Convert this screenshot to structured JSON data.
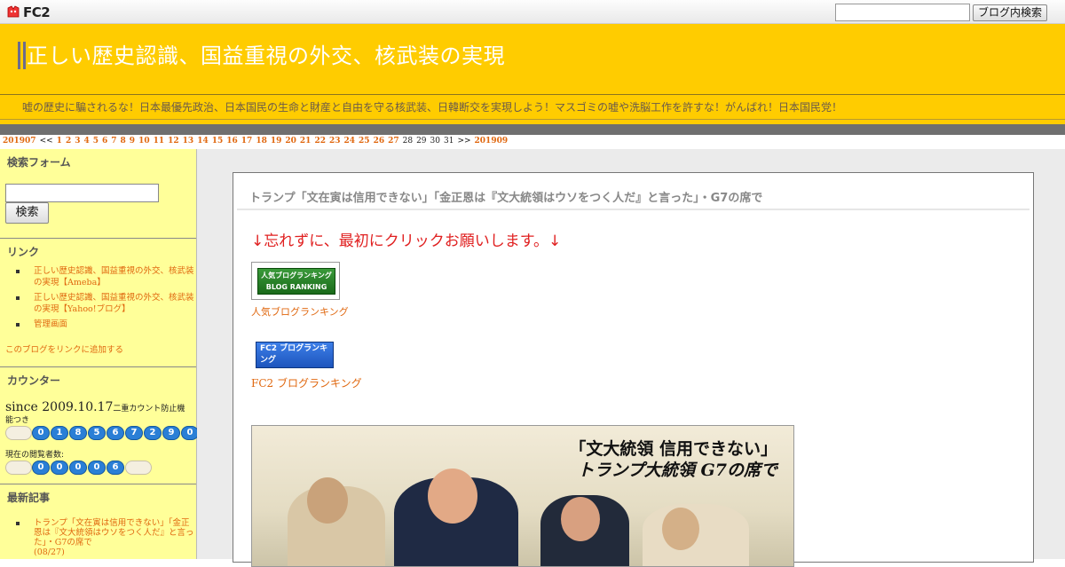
{
  "fc2bar": {
    "logo_text": "FC2",
    "search_button": "ブログ内検索"
  },
  "header": {
    "title": "正しい歴史認識、国益重視の外交、核武装の実現",
    "description": "嘘の歴史に騙されるな！日本最優先政治、日本国民の生命と財産と自由を守る核武装、日韓断交を実現しよう！マスゴミの嘘や洗脳工作を許すな！がんばれ！日本国民党！"
  },
  "calendar": {
    "prev_month": "201907",
    "prev_arrow": "<<",
    "linked_days": [
      "1",
      "2",
      "3",
      "4",
      "5",
      "6",
      "7",
      "8",
      "9",
      "10",
      "11",
      "12",
      "13",
      "14",
      "15",
      "16",
      "17",
      "18",
      "19",
      "20",
      "21",
      "22",
      "23",
      "24",
      "25",
      "26",
      "27"
    ],
    "plain_days": [
      "28",
      "29",
      "30",
      "31"
    ],
    "next_arrow": ">>",
    "next_month": "201909"
  },
  "sidebar": {
    "search_title": "検索フォーム",
    "search_button": "検索",
    "links_title": "リンク",
    "links": [
      "正しい歴史認識、国益重視の外交、核武装の実現【Ameba】",
      "正しい歴史認識、国益重視の外交、核武装の実現【Yahoo!ブログ】",
      "管理画面"
    ],
    "add_link": "このブログをリンクに追加する",
    "counter_title": "カウンター",
    "since": "since 2009.10.17",
    "since_note": "二重カウント防止機",
    "since_note2": "能つき",
    "total_digits": [
      "0",
      "1",
      "8",
      "5",
      "6",
      "7",
      "2",
      "9",
      "0"
    ],
    "current_label": "現在の閲覧者数:",
    "current_digits": [
      "0",
      "0",
      "0",
      "0",
      "6"
    ],
    "recent_title": "最新記事",
    "recent_item": "トランプ「文在寅は信用できない」「金正恩は『文大統領はウソをつく人だ』と言った」・G7の席で",
    "recent_date": "(08/27)"
  },
  "entry": {
    "title": "トランプ「文在寅は信用できない」「金正恩は『文大統領はウソをつく人だ』と言った」・G7の席で",
    "click_please": "↓忘れずに、最初にクリックお願いします。↓",
    "blog_ranking_img_text": "人気ブログランキング BLOG RANKING",
    "blog_ranking_link": "人気ブログランキング",
    "fc2_ranking_img_text": "FC2 ブログランキング",
    "fc2_ranking_link": "FC2 ブログランキング",
    "photo_caption_line1": "「文大統領 信用できない」",
    "photo_caption_line2": "トランプ大統領 G7の席で"
  },
  "colors": {
    "header_yellow": "#ffcc00",
    "sidebar_yellow": "#ffff99",
    "link_orange": "#e06810",
    "alert_red": "#e02020"
  }
}
